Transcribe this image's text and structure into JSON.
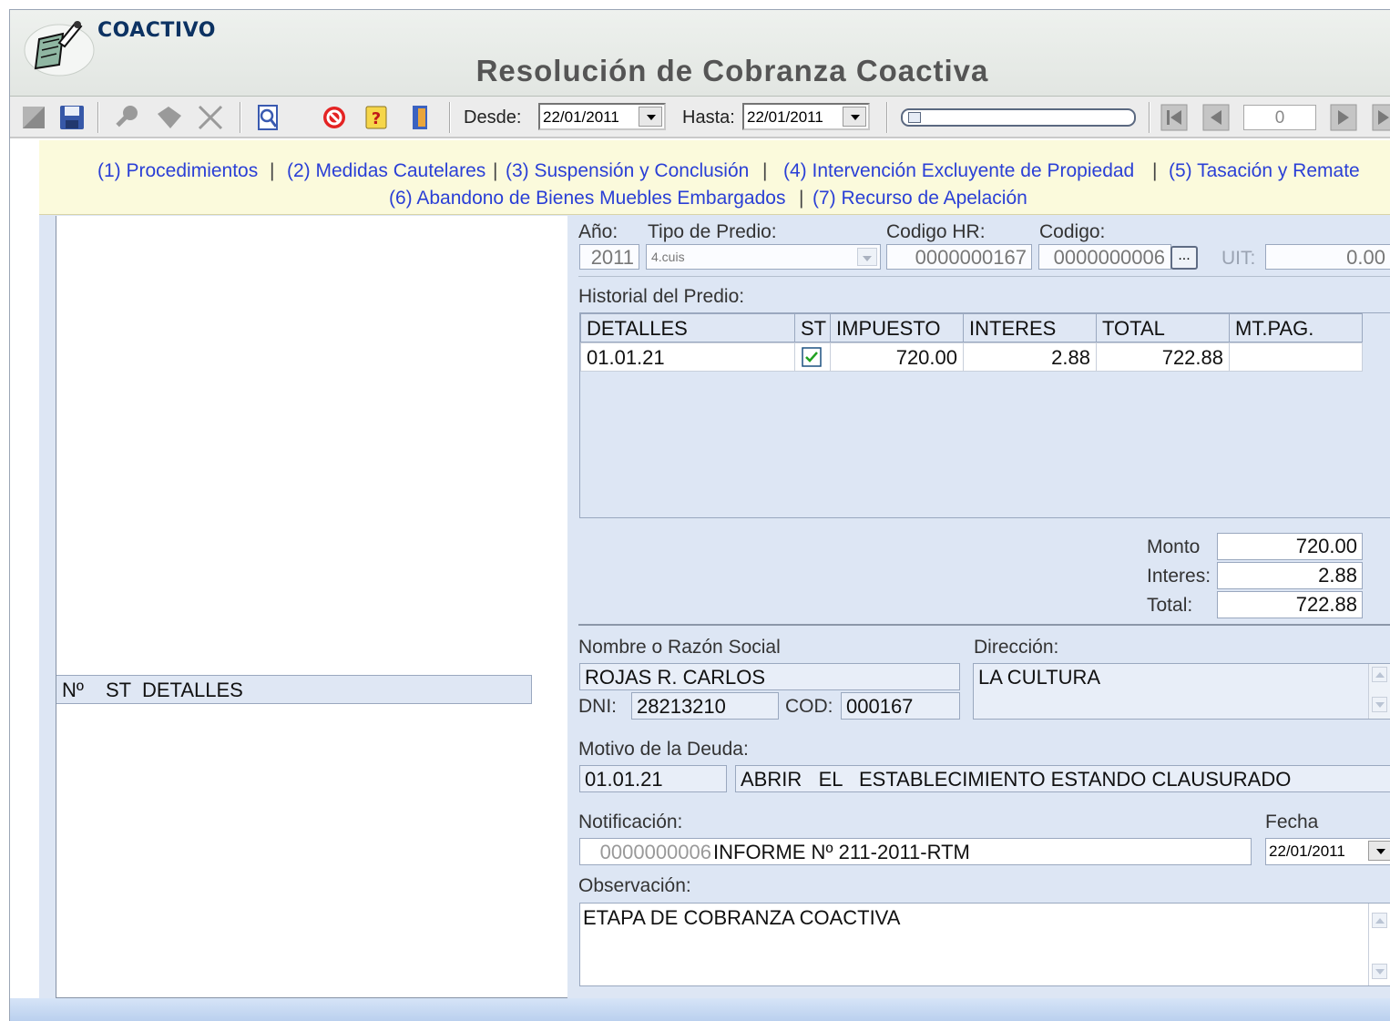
{
  "header": {
    "app_title": "COACTIVO",
    "form_title": "Resolución de Cobranza Coactiva"
  },
  "toolbar": {
    "icons": [
      "new-icon",
      "save-icon",
      "search-icon",
      "tag-icon",
      "delete-icon",
      "preview-icon",
      "dropdown-arrow-icon",
      "cancel-icon",
      "help-icon",
      "exit-icon"
    ],
    "desde_label": "Desde:",
    "desde_value": "22/01/2011",
    "hasta_label": "Hasta:",
    "hasta_value": "22/01/2011",
    "record_number": "0"
  },
  "links": {
    "row1": [
      "(1) Procedimientos",
      "(2) Medidas Cautelares",
      "(3) Suspensión y Conclusión",
      "(4) Intervención Excluyente de Propiedad",
      "(5) Tasación y Remate"
    ],
    "row2": [
      "(6) Abandono de Bienes Muebles Embargados",
      "(7) Recurso de Apelación"
    ]
  },
  "left_grid": {
    "headers": [
      "Nº",
      "ST",
      "DETALLES"
    ]
  },
  "predio": {
    "anio_label": "Año:",
    "anio_value": "2011",
    "tipo_label": "Tipo de Predio:",
    "tipo_value": "4.cuis",
    "codigo_hr_label": "Codigo HR:",
    "codigo_hr_value": "0000000167",
    "codigo_label": "Codigo:",
    "codigo_value": "0000000006",
    "lookup_label": "...",
    "uit_label": "UIT:",
    "uit_value": "0.00"
  },
  "historial": {
    "label": "Historial del Predio:",
    "headers": [
      "DETALLES",
      "ST",
      "IMPUESTO",
      "INTERES",
      "TOTAL",
      "MT.PAG."
    ],
    "rows": [
      {
        "detalles": "01.01.21",
        "st": true,
        "impuesto": "720.00",
        "interes": "2.88",
        "total": "722.88",
        "mt_pag": ""
      }
    ]
  },
  "totals": {
    "monto_label": "Monto",
    "monto": "720.00",
    "interes_label": "Interes:",
    "interes": "2.88",
    "total_label": "Total:",
    "total": "722.88"
  },
  "contribuyente": {
    "nombre_label": "Nombre o Razón Social",
    "nombre": "ROJAS R. CARLOS",
    "direccion_label": "Dirección:",
    "direccion": "LA CULTURA",
    "dni_label": "DNI:",
    "dni": "28213210",
    "cod_label": "COD:",
    "cod": "000167"
  },
  "deuda": {
    "label": "Motivo de la Deuda:",
    "codigo": "01.01.21",
    "descripcion": "ABRIR   EL   ESTABLECIMIENTO ESTANDO CLAUSURADO"
  },
  "notificacion": {
    "label": "Notificación:",
    "numero": "0000000006",
    "texto": "INFORME Nº 211-2011-RTM",
    "fecha_label": "Fecha",
    "fecha": "22/01/2011"
  },
  "observacion": {
    "label": "Observación:",
    "texto": "ETAPA DE COBRANZA COACTIVA"
  },
  "colors": {
    "link": "#2a3fd6",
    "panel_bg": "#dde6f4",
    "links_bg": "#fbfadc",
    "title": "#0c3262"
  }
}
